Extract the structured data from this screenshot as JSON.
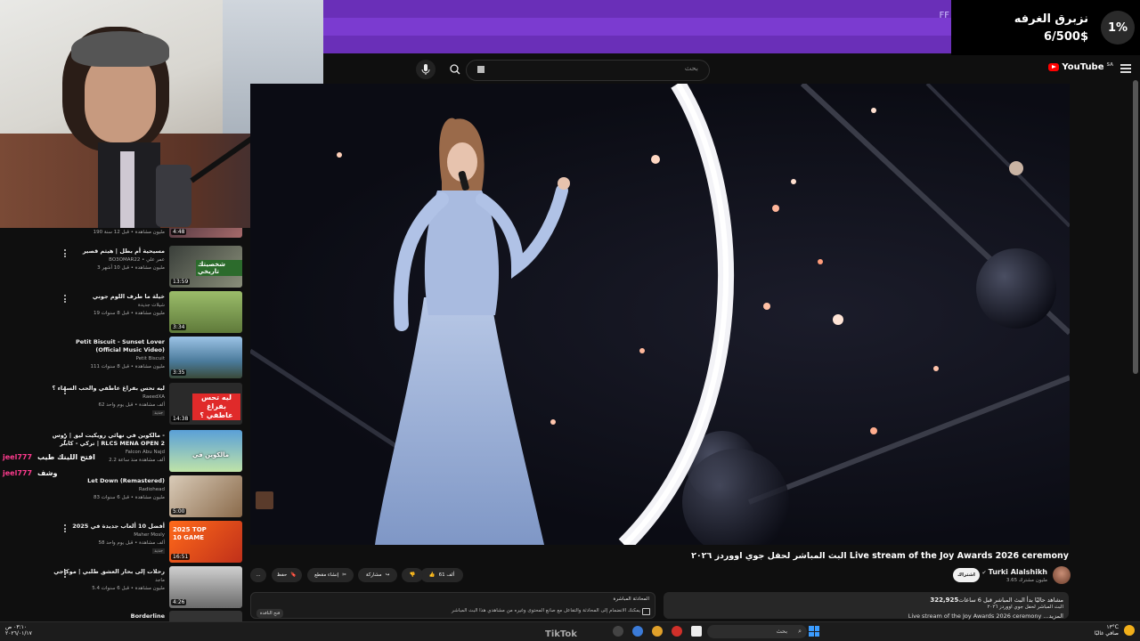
{
  "overlay": {
    "donation_title": "نزبرق الغرفه",
    "donation_amount": "6/500$",
    "donation_percent": "1%",
    "topbar_text": "FF"
  },
  "colors": {
    "purple": "#6a2fb8",
    "youtube_red": "#ff0000",
    "chat_username": "#ff3b8e"
  },
  "header": {
    "search_placeholder": "بحث",
    "logo_text": "YouTube",
    "logo_region": "SA",
    "icons": [
      "mic-icon",
      "search-icon",
      "menu-icon"
    ]
  },
  "video": {
    "title": "البث المباشر لحفل جوي اووردز ٢٠٢٦ Live stream of the Joy Awards 2026 ceremony",
    "channel_name": "Turki Alalshikh",
    "channel_verified_icon": "verified-icon",
    "subscribers": "3.65 مليون مشترك",
    "subscribe_label": "اشتراك",
    "likes": "61 ألف",
    "share_label": "مشاركة",
    "clip_label": "إنشاء مقطع",
    "save_label": "حفظ",
    "more_label": "..."
  },
  "description": {
    "views": "322,925",
    "line1": "مشاهد حاليًا بدأ البث المباشر قبل 6 ساعات",
    "line2": "البث المباشر لحفل جوي اووردز ٢٠٢٦",
    "line3": "Live stream of the Joy Awards 2026 ceremony ...المزيد"
  },
  "live_chat": {
    "header": "المحادثة المباشرة",
    "text": "يمكنك الانضمام إلى المحادثة والتفاعل مع صانع المحتوى وغيره من مشاهدي هذا البث المباشر",
    "button": "فتح النافذة"
  },
  "recommendations": [
    {
      "title1": "",
      "title2": "",
      "channel": "",
      "meta": "190 مليون مشاهدة • قبل 12 سنة",
      "duration": "4:48"
    },
    {
      "title1": "مسيحية أم بطل | هيثم قصير",
      "title2": "",
      "channel": "BO3OMAR22 • عمر علي",
      "meta": "3 مليون مشاهدة • قبل 10 أشهر",
      "duration": "13:59"
    },
    {
      "title1": "خيلة ما طرف اللوم جوني",
      "title2": "",
      "channel": "شيلات جديدة",
      "meta": "19 مليون مشاهدة • قبل 8 سنوات",
      "duration": "3:34"
    },
    {
      "title1": "Petit Biscuit - Sunset Lover",
      "title2": "(Official Music Video)",
      "channel": "Petit Biscuit",
      "meta": "111 مليون مشاهدة • قبل 8 سنوات",
      "duration": "3:35"
    },
    {
      "title1": "ليه تحس بفراغ عاطفي والحب السماء ؟",
      "title2": "",
      "channel": "RaeedXA",
      "meta": "62 ألف مشاهدة • قبل يوم واحد",
      "duration": "14:38",
      "badge": "جديد"
    },
    {
      "title1": "مالكوين في نهائي رويكيت ليق | روس -",
      "title2": "تركي - كابلر | RLCS MENA OPEN 2",
      "channel": "Falcon Abu Najd",
      "meta": "2.2 ألف مشاهدة منذ ساعة",
      "duration": ""
    },
    {
      "title1": "Let Down (Remastered)",
      "title2": "",
      "channel": "Radiohead",
      "meta": "83 مليون مشاهدة • قبل 6 سنوات",
      "duration": "5:00"
    },
    {
      "title1": "أفضل 10 ألعاب جديدة في 2025",
      "title2": "",
      "channel": "Maher Mosly",
      "meta": "58 ألف مشاهدة • قبل يوم واحد",
      "duration": "16:51",
      "badge": "جديد"
    },
    {
      "title1": "رحلات إلى بحار العشق طلبي | موكاجي",
      "title2": "",
      "channel": "ماجد",
      "meta": "5.4 مليون مشاهدة • قبل 6 سنوات",
      "duration": "4:26"
    },
    {
      "title1": "Borderline",
      "title2": "",
      "channel": "",
      "meta": "",
      "duration": ""
    }
  ],
  "thumb_texts": {
    "t1": "شخصيتك تاريخي",
    "t4": "ليه تحس بفراغ عاطفي ؟",
    "t5": "مالكوين في",
    "t7": "2025 TOP 10 GAME"
  },
  "stream_chat": [
    {
      "user": "jeel777",
      "message": "افتح اللينك طيب"
    },
    {
      "user": "jeel777",
      "message": "وشف"
    }
  ],
  "taskbar": {
    "time": "٠٣:١٠ ص",
    "date": "٢٠٢٦/٠١/١٧",
    "search_placeholder": "بحث",
    "weather_temp": "١٣°C",
    "weather_desc": "صافي غالبًا",
    "tiktok_label": "TikTok"
  }
}
